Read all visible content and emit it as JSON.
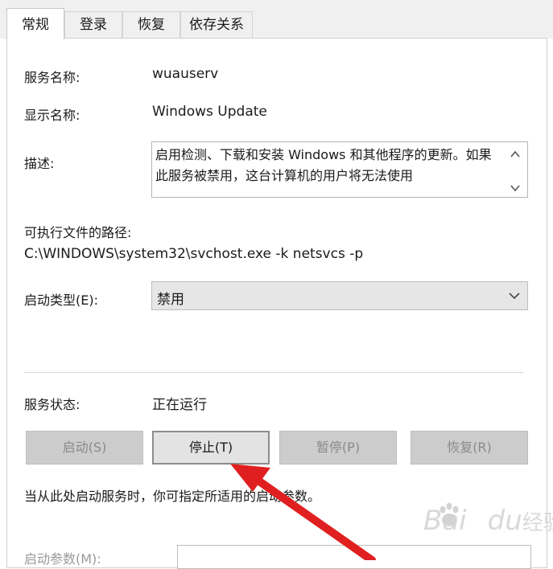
{
  "tabs": [
    {
      "label": "常规",
      "active": true
    },
    {
      "label": "登录",
      "active": false
    },
    {
      "label": "恢复",
      "active": false
    },
    {
      "label": "依存关系",
      "active": false
    }
  ],
  "fields": {
    "service_name_label": "服务名称:",
    "service_name_value": "wuauserv",
    "display_name_label": "显示名称:",
    "display_name_value": "Windows Update",
    "description_label": "描述:",
    "description_value": "启用检测、下载和安装 Windows 和其他程序的更新。如果此服务被禁用，这台计算机的用户将无法使用",
    "path_label": "可执行文件的路径:",
    "path_value": "C:\\WINDOWS\\system32\\svchost.exe -k netsvcs -p",
    "startup_type_label": "启动类型(E):",
    "startup_type_value": "禁用",
    "status_label": "服务状态:",
    "status_value": "正在运行"
  },
  "buttons": {
    "start": "启动(S)",
    "stop": "停止(T)",
    "pause": "暂停(P)",
    "resume": "恢复(R)"
  },
  "hint_text": "当从此处启动服务时，你可指定所适用的启动参数。",
  "start_params_label": "启动参数(M):",
  "watermark": {
    "text_latin": "Bai",
    "text_latin2": "du",
    "text_cn": "经验"
  },
  "colors": {
    "annotation_arrow": "#e02020",
    "disabled_button": "#cccccc",
    "enabled_button": "#e3e3e3"
  },
  "icons": [
    "chevron-up-icon",
    "chevron-down-icon",
    "dropdown-arrow-icon",
    "baidu-paw-icon"
  ]
}
